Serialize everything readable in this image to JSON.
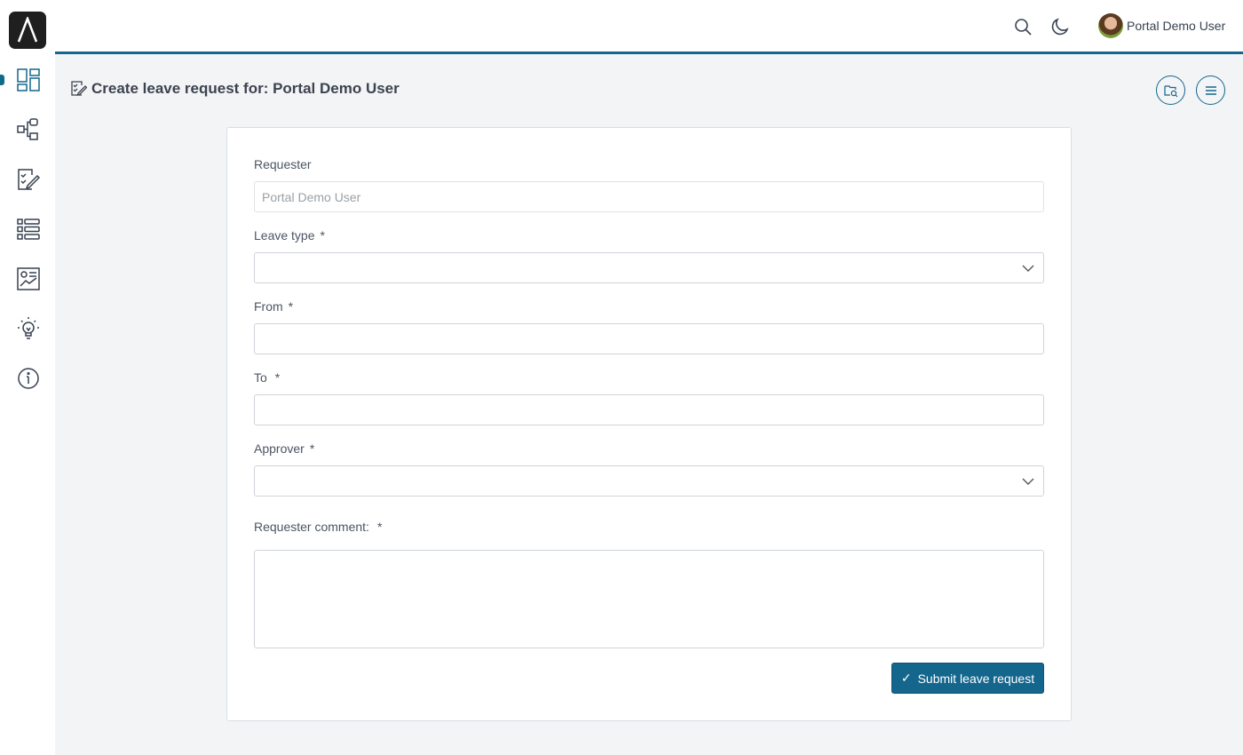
{
  "header": {
    "user_name": "Portal Demo User"
  },
  "sidebar": {
    "items": [
      {
        "icon": "dashboard-icon"
      },
      {
        "icon": "process-icon"
      },
      {
        "icon": "tasks-icon"
      },
      {
        "icon": "cases-icon"
      },
      {
        "icon": "statistics-icon"
      },
      {
        "icon": "ideas-icon"
      },
      {
        "icon": "info-icon"
      }
    ]
  },
  "page": {
    "title": "Create leave request for: Portal Demo User"
  },
  "form": {
    "requester_label": "Requester",
    "requester_value": "Portal Demo User",
    "leave_type_label": "Leave type",
    "from_label": "From",
    "to_label": "To",
    "approver_label": "Approver",
    "comment_label": "Requester comment:",
    "required_mark": "*",
    "submit_label": "Submit leave request",
    "submit_check": "✓"
  },
  "colors": {
    "accent": "#14668c"
  }
}
